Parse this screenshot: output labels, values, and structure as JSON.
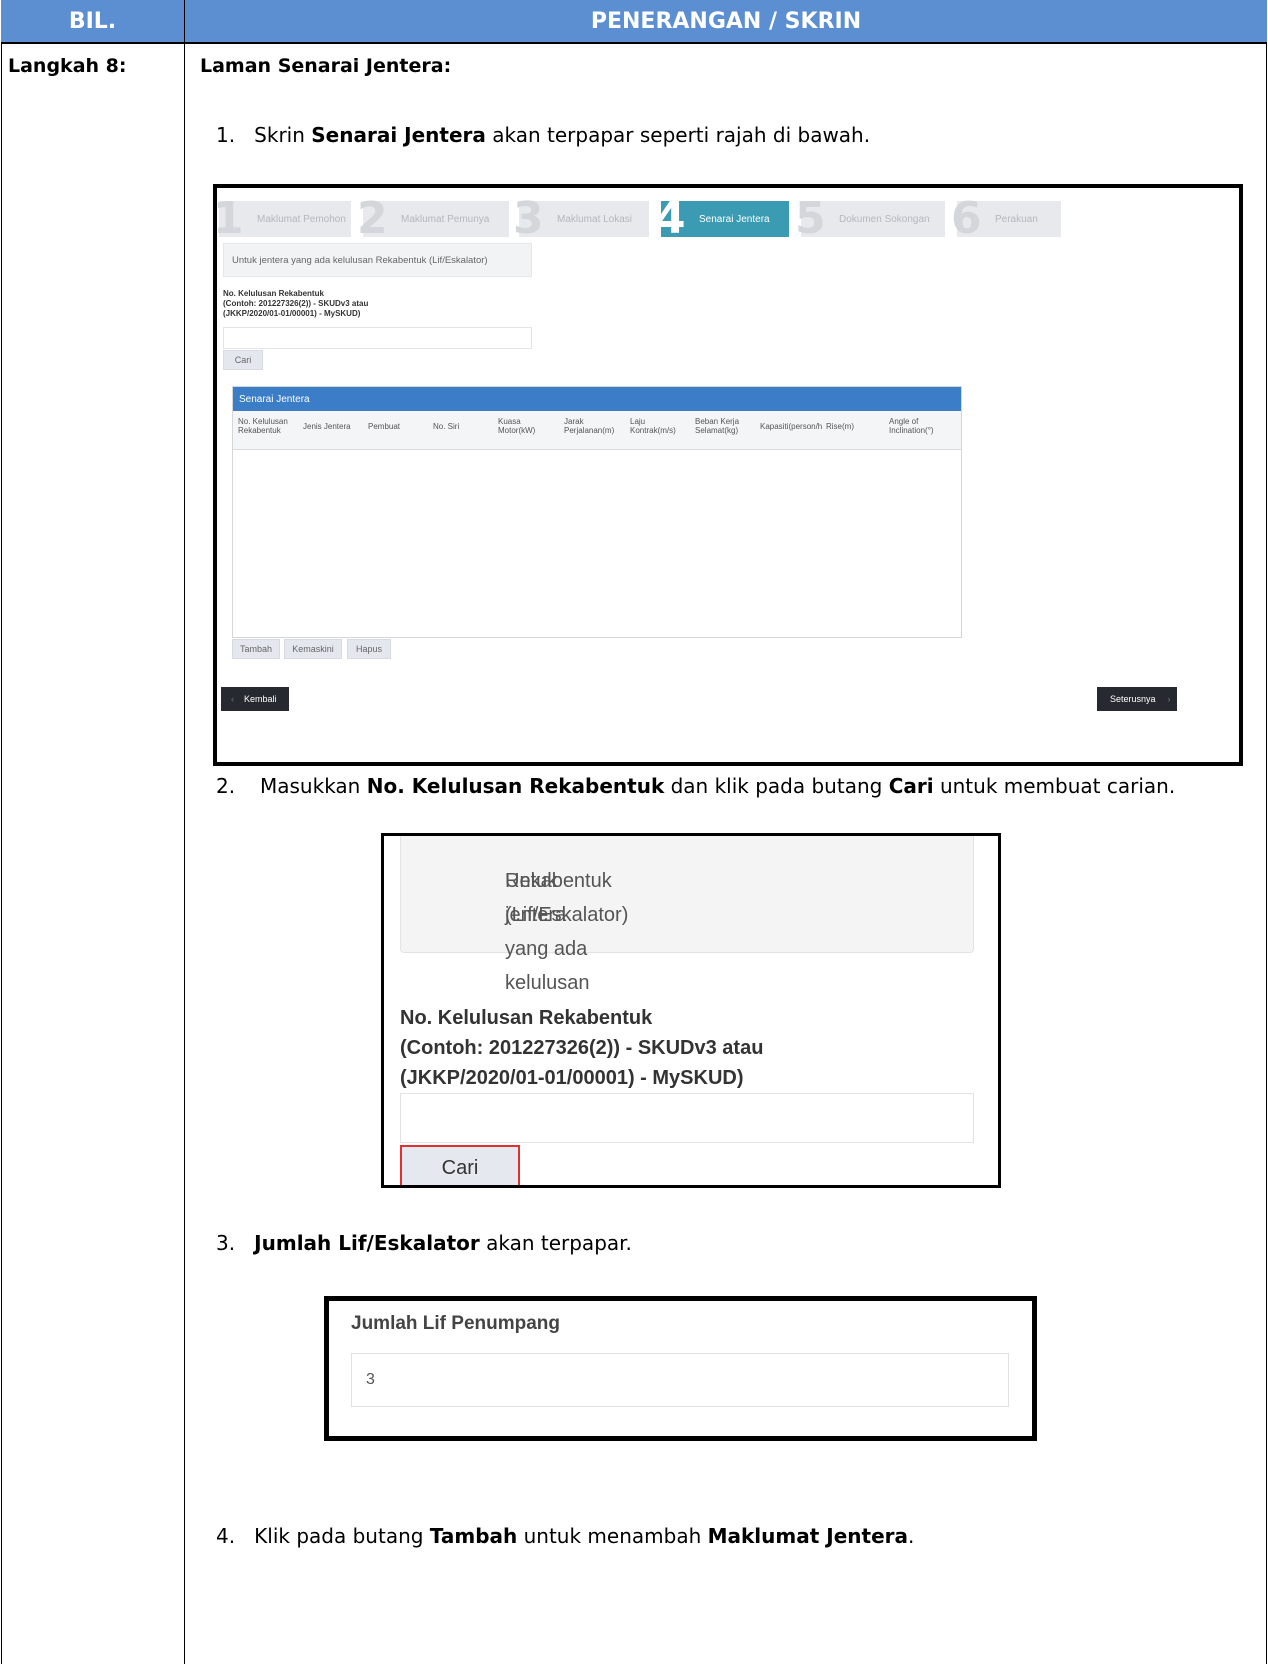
{
  "table": {
    "col1_header": "BIL.",
    "col2_header": "PENERANGAN / SKRIN",
    "step_label": "Langkah 8:",
    "section_title": "Laman Senarai Jentera:"
  },
  "instructions": {
    "i1": {
      "num": "1.",
      "pre": "Skrin ",
      "bold": "Senarai Jentera",
      "post": " akan terpapar seperti rajah di bawah."
    },
    "i2": {
      "num": "2.",
      "pre": "Masukkan ",
      "bold1": "No. Kelulusan Rekabentuk",
      "mid": " dan klik pada butang ",
      "bold2": "Cari",
      "post": " untuk membuat carian."
    },
    "i3": {
      "num": "3.",
      "bold": "Jumlah Lif/Eskalator",
      "post": " akan terpapar."
    },
    "i4": {
      "num": "4.",
      "pre": "Klik pada butang ",
      "bold1": "Tambah",
      "mid": " untuk menambah ",
      "bold2": "Maklumat Jentera",
      "post": "."
    }
  },
  "shot1": {
    "steps": [
      {
        "num": "1",
        "label": "Maklumat Pemohon"
      },
      {
        "num": "2",
        "label": "Maklumat Pemunya"
      },
      {
        "num": "3",
        "label": "Maklumat Lokasi"
      },
      {
        "num": "4",
        "label": "Senarai Jentera"
      },
      {
        "num": "5",
        "label": "Dokumen Sokongan"
      },
      {
        "num": "6",
        "label": "Perakuan"
      }
    ],
    "note": "Untuk jentera yang ada kelulusan Rekabentuk (Lif/Eskalator)",
    "label_l1": "No. Kelulusan Rekabentuk",
    "label_l2": "(Contoh: 201227326(2)) - SKUDv3 atau",
    "label_l3": "(JKKP/2020/01-01/00001) - MySKUD)",
    "search_btn": "Cari",
    "grid_title": "Senarai Jentera",
    "columns": [
      "No. Kelulusan Rekabentuk",
      "Jenis Jentera",
      "Pembuat",
      "No. Siri",
      "Kuasa Motor(kW)",
      "Jarak Perjalanan(m)",
      "Laju Kontrak(m/s)",
      "Beban Kerja Selamat(kg)",
      "Kapasiti(person/h",
      "Rise(m)",
      "Angle of Inclination(°)"
    ],
    "btn_add": "Tambah",
    "btn_edit": "Kemaskini",
    "btn_delete": "Hapus",
    "btn_back": "Kembali",
    "btn_next": "Seterusnya",
    "chev_left": "‹",
    "chev_right": "›"
  },
  "shot2": {
    "note_l1": "Untuk jentera yang ada kelulusan",
    "note_l2": "Rekabentuk (Lif/Eskalator)",
    "label_l1": "No. Kelulusan Rekabentuk",
    "label_l2": "(Contoh: 201227326(2)) - SKUDv3 atau",
    "label_l3": "(JKKP/2020/01-01/00001) - MySKUD)",
    "btn": "Cari"
  },
  "shot3": {
    "label": "Jumlah Lif Penumpang",
    "value": "3"
  }
}
